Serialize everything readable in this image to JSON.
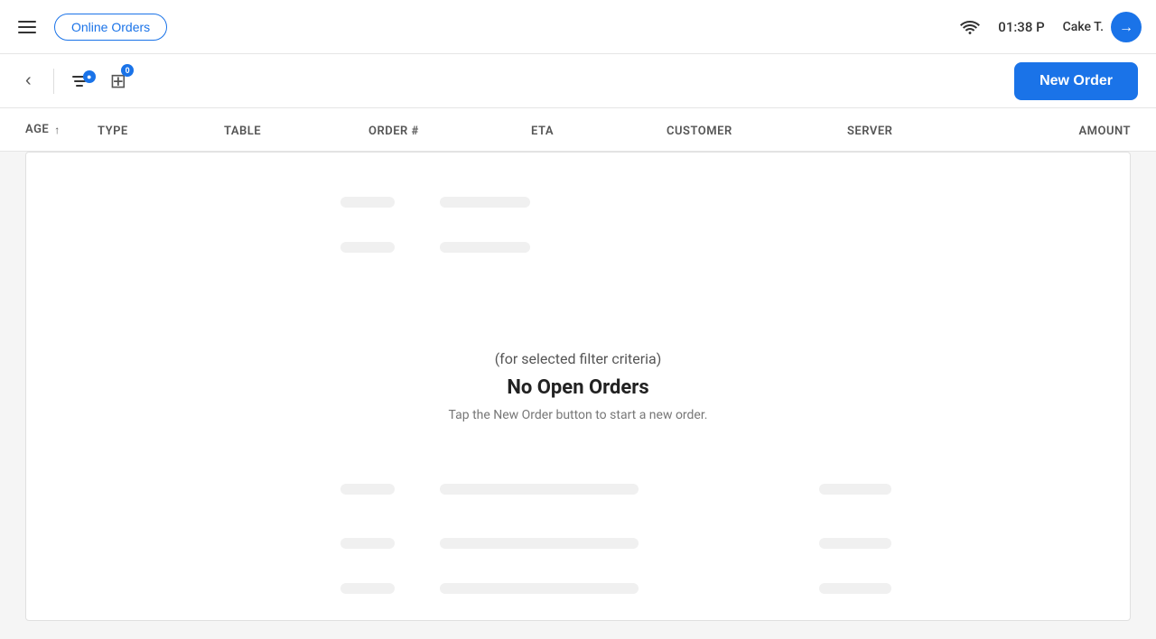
{
  "topbar": {
    "online_orders_label": "Online Orders",
    "time": "01:38 P",
    "user_name": "Cake T.",
    "user_avatar_initial": "→"
  },
  "toolbar": {
    "filter_badge": "●",
    "register_badge": "0",
    "new_order_label": "New Order"
  },
  "table_header": {
    "age": "AGE",
    "type": "TYPE",
    "table": "TABLE",
    "order_num": "ORDER #",
    "eta": "ETA",
    "customer": "CUSTOMER",
    "server": "SERVER",
    "amount": "AMOUNT"
  },
  "empty_state": {
    "filter_text": "(for selected filter criteria)",
    "title": "No Open Orders",
    "subtitle": "Tap the New Order button to start a new order."
  }
}
